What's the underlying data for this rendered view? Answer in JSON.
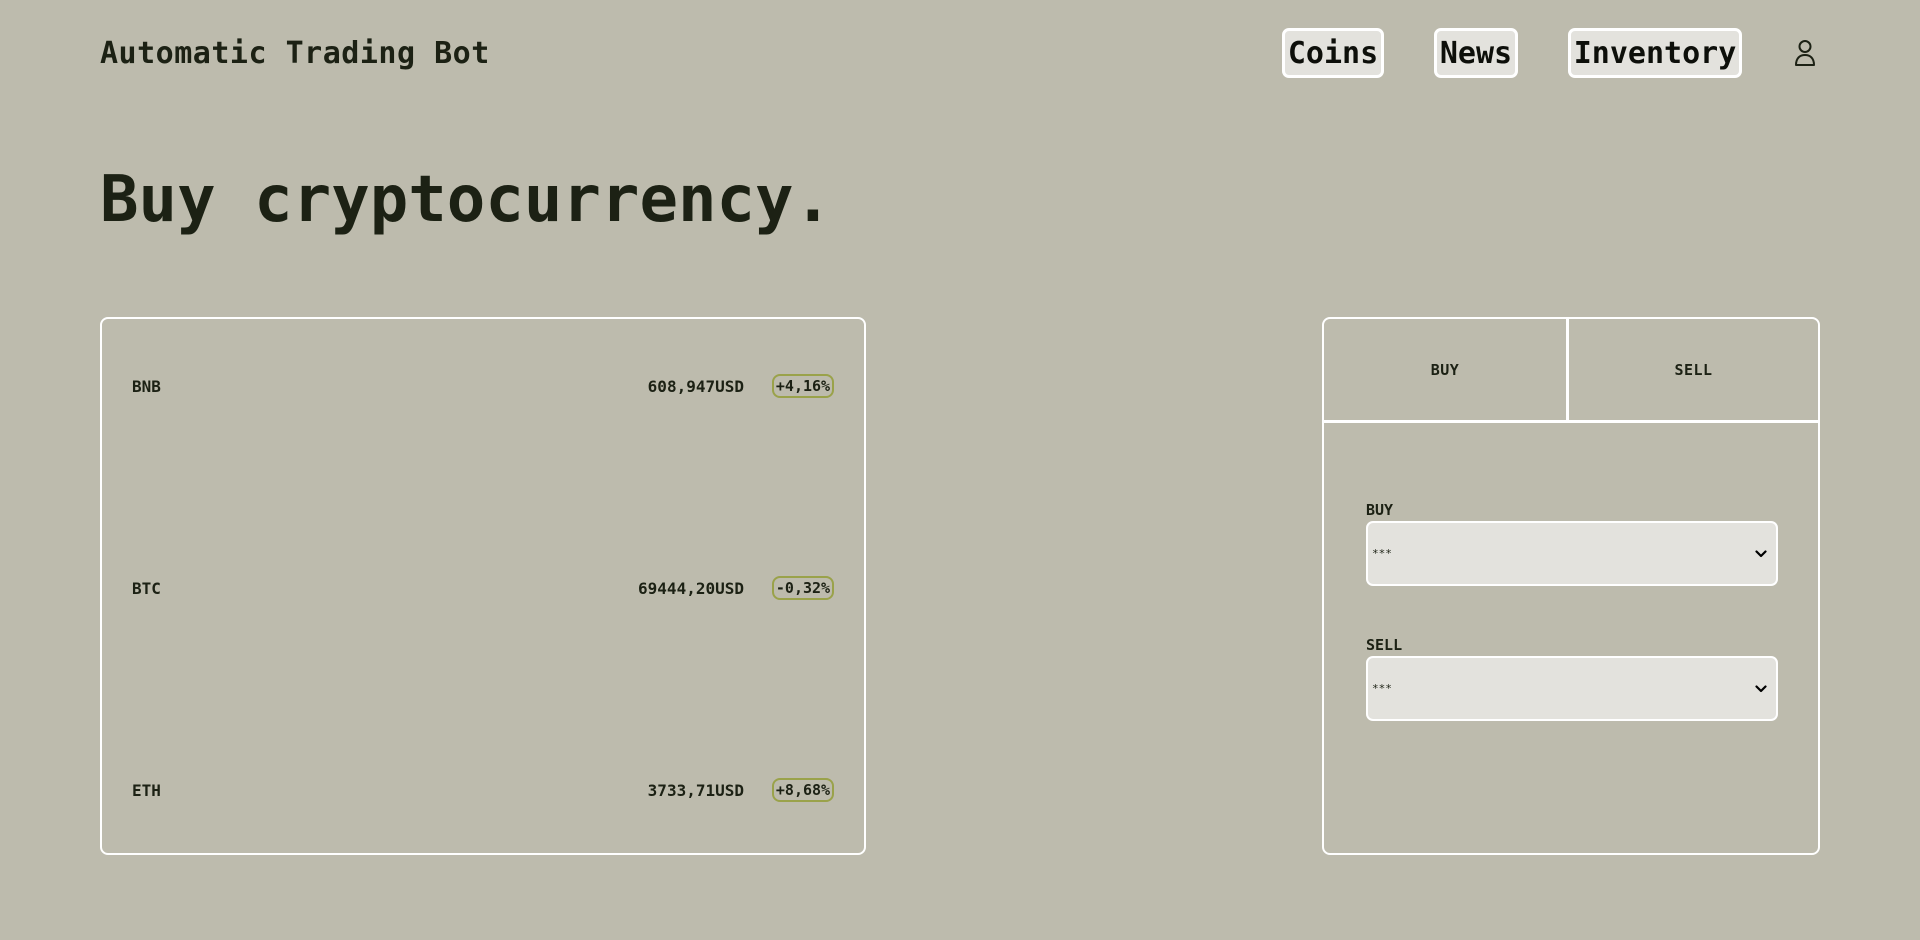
{
  "header": {
    "title": "Automatic Trading Bot",
    "nav": {
      "coins": "Coins",
      "news": "News",
      "inventory": "Inventory"
    },
    "user_icon": "user-icon"
  },
  "hero": {
    "heading": "Buy cryptocurrency."
  },
  "coins": [
    {
      "symbol": "BNB",
      "price": "608,947USD",
      "change": "+4,16%"
    },
    {
      "symbol": "BTC",
      "price": "69444,20USD",
      "change": "-0,32%"
    },
    {
      "symbol": "ETH",
      "price": "3733,71USD",
      "change": "+8,68%"
    }
  ],
  "trade": {
    "tabs": {
      "buy": "BUY",
      "sell": "SELL"
    },
    "buy_label": "BUY",
    "buy_value": "***",
    "sell_label": "SELL",
    "sell_value": "***"
  },
  "colors": {
    "background": "#bdbbad",
    "text": "#1c2114",
    "border": "#ffffff",
    "button_bg": "#e3e2dd",
    "badge_border": "#9aa24a"
  }
}
